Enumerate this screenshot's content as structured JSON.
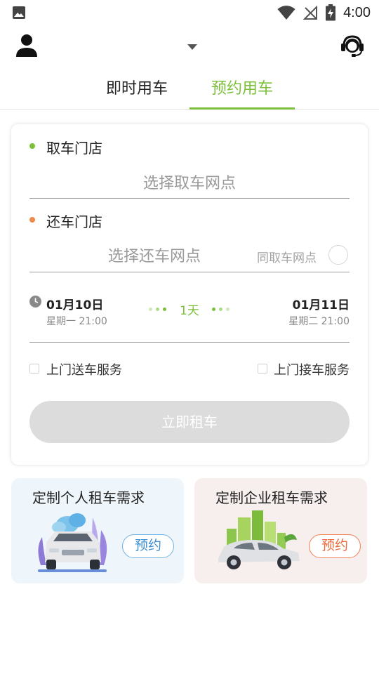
{
  "status_bar": {
    "time": "4:00",
    "icons": [
      "photo-icon",
      "wifi-icon",
      "no-signal-icon",
      "battery-charging-icon"
    ]
  },
  "header": {
    "city_selector": "",
    "icons": [
      "user-icon",
      "chevron-down-icon",
      "customer-service-icon"
    ]
  },
  "tabs": [
    {
      "label": "即时用车",
      "active": false
    },
    {
      "label": "预约用车",
      "active": true
    }
  ],
  "booking": {
    "pickup_store_label": "取车门店",
    "pickup_placeholder": "选择取车网点",
    "return_store_label": "还车门店",
    "return_placeholder": "选择还车网点",
    "same_store_label": "同取车网点",
    "start_date": "01月10日",
    "start_weekday_time": "星期一 21:00",
    "duration": "1天",
    "end_date": "01月11日",
    "end_weekday_time": "星期二 21:00",
    "delivery_service_label": "上门送车服务",
    "pickup_service_label": "上门接车服务",
    "submit_label": "立即租车"
  },
  "promos": [
    {
      "title": "定制个人租车需求",
      "button": "预约"
    },
    {
      "title": "定制企业租车需求",
      "button": "预约"
    }
  ],
  "colors": {
    "accent_green": "#7cbf3a",
    "accent_orange": "#f08a4b",
    "disabled_button": "#dcdcdc",
    "personal_blue": "#3d8fd2",
    "business_orange": "#e86b3e"
  }
}
